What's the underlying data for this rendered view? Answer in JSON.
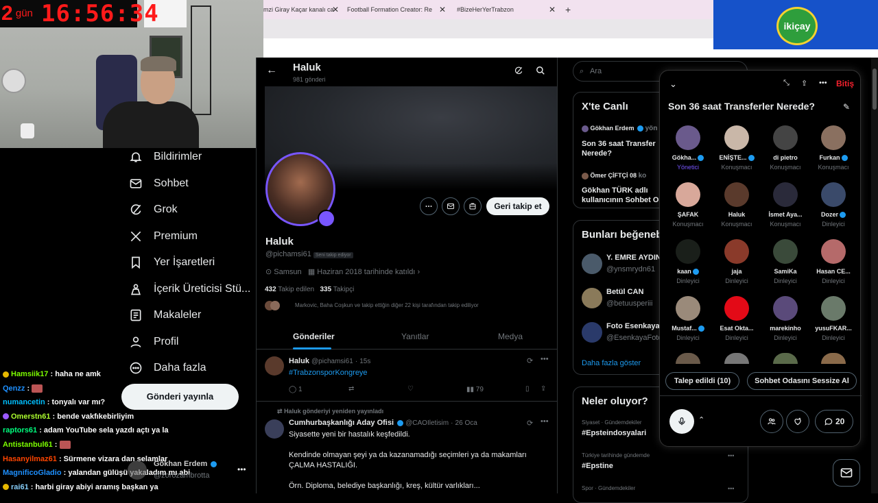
{
  "stream": {
    "timer": "16:56:34",
    "day_prefix": "2",
    "day_word": "gün"
  },
  "browser": {
    "tabs": [
      {
        "label": "mzi Giray Kaçar kanalı ca"
      },
      {
        "label": "Football Formation Creator: Re"
      },
      {
        "label": "#BizeHerYerTrabzon"
      }
    ],
    "new_tab": "+"
  },
  "ad": {
    "brand": "ikiçay"
  },
  "nav": {
    "items": [
      {
        "label": "Bildirimler"
      },
      {
        "label": "Sohbet"
      },
      {
        "label": "Grok"
      },
      {
        "label": "Premium"
      },
      {
        "label": "Yer İşaretleri"
      },
      {
        "label": "İçerik Üreticisi Stü..."
      },
      {
        "label": "Makaleler"
      },
      {
        "label": "Profil"
      },
      {
        "label": "Daha fazla"
      }
    ],
    "post_button": "Gönderi yayınla"
  },
  "chat": [
    {
      "user": "Hamsiik17",
      "msg": ": haha ne amk",
      "color": "#7CFC00",
      "emote": false
    },
    {
      "user": "Qenzz",
      "msg": ":",
      "color": "#1E90FF",
      "emote": true
    },
    {
      "user": "numancetin",
      "msg": ": tonyalı var mı?",
      "color": "#00BFFF",
      "emote": false
    },
    {
      "user": "Omerstn61",
      "msg": ": bende vakfıkebirliyim",
      "color": "#ADFF2F",
      "emote": false
    },
    {
      "user": "raptors61",
      "msg": ": adam YouTube sela yazdı açtı ya la",
      "color": "#00FF7F",
      "emote": false
    },
    {
      "user": "Antistanbul61",
      "msg": ":",
      "color": "#7CFC00",
      "emote": true
    },
    {
      "user": "Hasanyilmaz61",
      "msg": ": Sürmene vizara dan selamlar",
      "color": "#FF4500",
      "emote": false
    },
    {
      "user": "MagnificoGladio",
      "msg": ": yalandan gülüşü yakaladım mı abi",
      "color": "#1E90FF",
      "emote": false
    },
    {
      "user": "rai61",
      "msg": ": harbi giray abiyi aramış başkan ya",
      "color": "#87CEFA",
      "emote": false
    }
  ],
  "account": {
    "name": "Gökhan Erdem",
    "handle": "@zorozambrotta"
  },
  "profile": {
    "name": "Haluk",
    "posts_count": "981 gönderi",
    "display_name": "Haluk",
    "handle": "@pichamsi61",
    "follows_you": "Seni takip ediyor",
    "location": "Samsun",
    "joined": "Haziran 2018 tarihinde katıldı",
    "following_count": "432",
    "following_label": "Takip edilen",
    "followers_count": "335",
    "followers_label": "Takipçi",
    "followed_by": "Markovic, Baha Coşkun ve takip ettiğin diğer 22 kişi tarafından takip ediliyor",
    "follow_back": "Geri takip et",
    "tabs": [
      "Gönderiler",
      "Yanıtlar",
      "Medya"
    ]
  },
  "tweets": [
    {
      "name": "Haluk",
      "handle": "@pichamsi61",
      "time": "15s",
      "text": "#TrabzonsporKongreye",
      "replies": "1",
      "views": "79"
    },
    {
      "repost_note": "Haluk gönderiyi yeniden yayınladı",
      "name": "Cumhurbaşkanlığı Aday Ofisi",
      "handle": "@CAOIletisim",
      "time": "26 Oca",
      "line1": "Siyasette yeni bir hastalık keşfedildi.",
      "line2": "Kendinde olmayan şeyi ya da kazanamadığı seçimleri ya da makamları ÇALMA HASTALIĞI.",
      "line3": "Örn. Diploma, belediye başkanlığı, kreş, kültür varlıkları..."
    }
  ],
  "right": {
    "search_placeholder": "Ara",
    "live_title": "X'te Canlı",
    "live_items": [
      {
        "host": "Gökhan Erdem",
        "suffix": "yön",
        "title": "Son 36 saat Transfer Nerede?"
      },
      {
        "host": "Ömer ÇİFTÇİ 08",
        "suffix": "ko",
        "title": "Gökhan TÜRK adlı kullanıcının Sohbet O"
      }
    ],
    "like_title": "Bunları beğeneb",
    "suggestions": [
      {
        "name": "Y. EMRE AYDIN",
        "handle": "@ynsmrydn61"
      },
      {
        "name": "Betül CAN",
        "handle": "@betuusperiii"
      },
      {
        "name": "Foto Esenkaya",
        "handle": "@EsenkayaFoto"
      }
    ],
    "show_more": "Daha fazla göster",
    "trends_title": "Neler oluyor?",
    "trends": [
      {
        "meta": "Siyaset · Gündemdekiler",
        "tag": "#Epsteindosyalari"
      },
      {
        "meta": "Türkiye tarihinde gündemde",
        "tag": "#Epstine"
      },
      {
        "meta": "Spor · Gündemdekiler",
        "tag": ""
      }
    ]
  },
  "space": {
    "title": "Son 36 saat Transferler Nerede?",
    "end_label": "Bitiş",
    "participants": [
      {
        "name": "Gökha...",
        "role": "Yönetici",
        "verified": true,
        "color": "#6a5a8c"
      },
      {
        "name": "ENİŞTE...",
        "role": "Konuşmacı",
        "verified": true,
        "color": "#c9b7a8"
      },
      {
        "name": "di pietro",
        "role": "Konuşmacı",
        "verified": false,
        "color": "#444"
      },
      {
        "name": "Furkan",
        "role": "Konuşmacı",
        "verified": true,
        "color": "#8a7060"
      },
      {
        "name": "ŞAFAK",
        "role": "Konuşmacı",
        "verified": false,
        "color": "#d8a89a"
      },
      {
        "name": "Haluk",
        "role": "Konuşmacı",
        "verified": false,
        "color": "#5a3a2c"
      },
      {
        "name": "İsmet Aya...",
        "role": "Konuşmacı",
        "verified": false,
        "color": "#2a2a3a"
      },
      {
        "name": "Dozer",
        "role": "Dinleyici",
        "verified": true,
        "color": "#3a4a6a"
      },
      {
        "name": "kaan",
        "role": "Dinleyici",
        "verified": true,
        "color": "#1a1f1a"
      },
      {
        "name": "jaja",
        "role": "Dinleyici",
        "verified": false,
        "color": "#8a3a2a"
      },
      {
        "name": "SamiKa",
        "role": "Dinleyici",
        "verified": false,
        "color": "#3a4a3a"
      },
      {
        "name": "Hasan CE...",
        "role": "Dinleyici",
        "verified": false,
        "color": "#b56a6a"
      },
      {
        "name": "Mustaf...",
        "role": "Dinleyici",
        "verified": true,
        "color": "#9a8a7a"
      },
      {
        "name": "Esat Okta...",
        "role": "Dinleyici",
        "verified": false,
        "color": "#e30a17"
      },
      {
        "name": "marekinho",
        "role": "Dinleyici",
        "verified": false,
        "color": "#5a4a7a"
      },
      {
        "name": "yusuFKAR...",
        "role": "Dinleyici",
        "verified": false,
        "color": "#6a7a6a"
      }
    ],
    "requests": "Talep edildi (10)",
    "mute_room": "Sohbet Odasını Sessize Al",
    "reply_count": "20"
  }
}
